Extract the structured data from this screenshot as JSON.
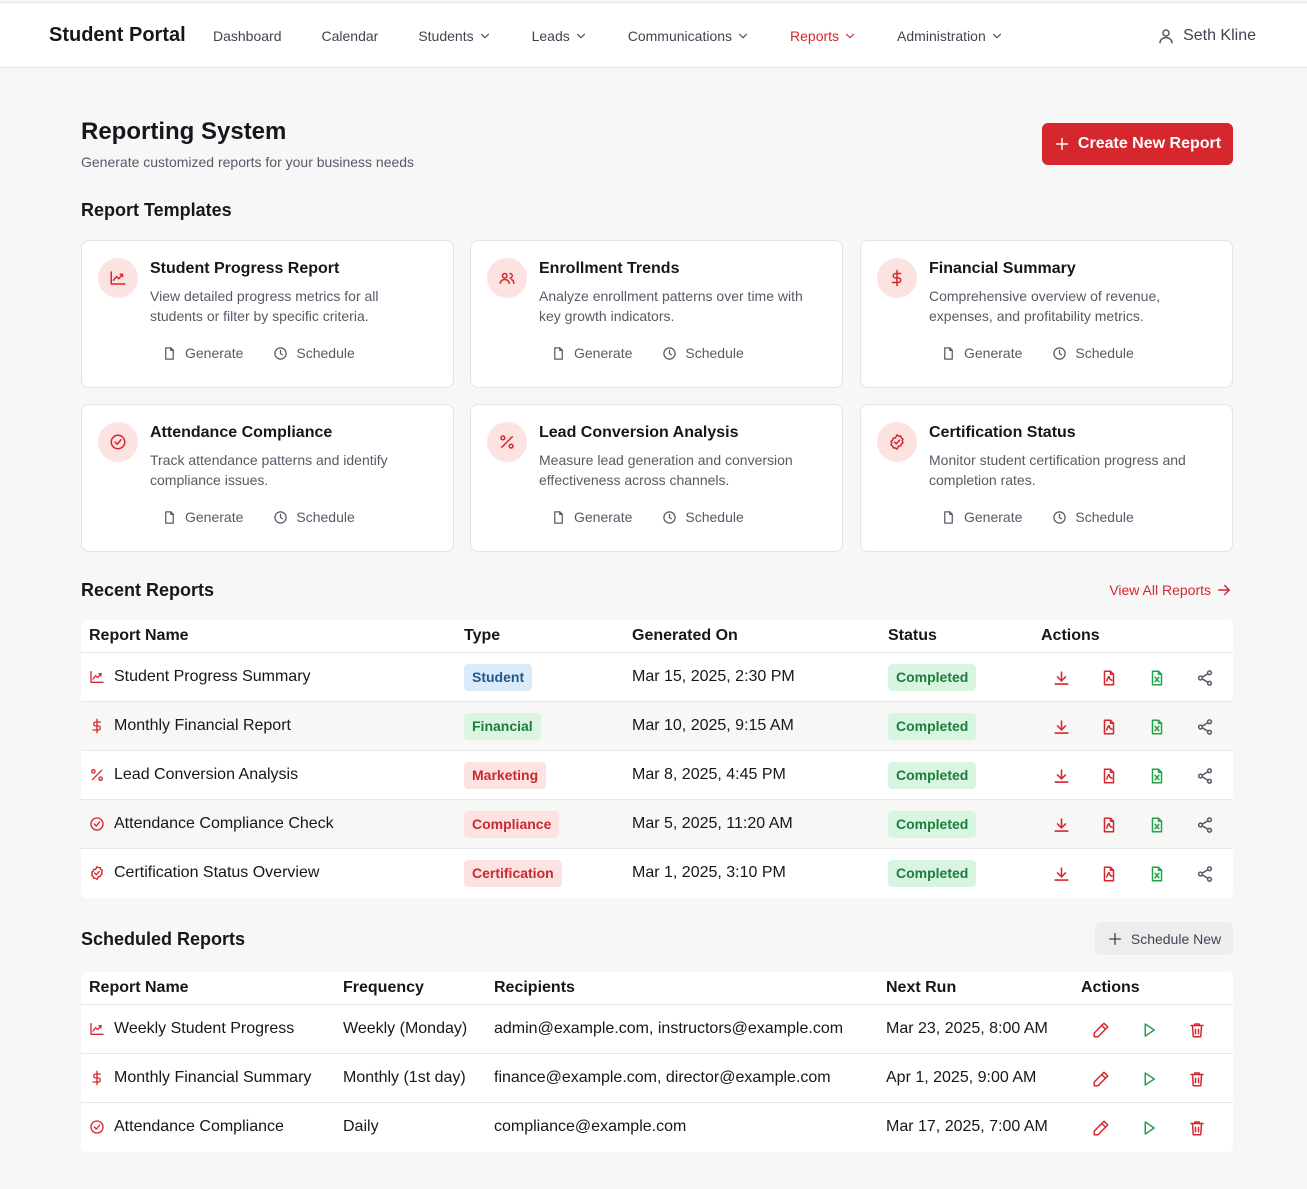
{
  "brand": "Student Portal",
  "nav": [
    {
      "label": "Dashboard",
      "dropdown": false
    },
    {
      "label": "Calendar",
      "dropdown": false
    },
    {
      "label": "Students",
      "dropdown": true
    },
    {
      "label": "Leads",
      "dropdown": true
    },
    {
      "label": "Communications",
      "dropdown": true
    },
    {
      "label": "Reports",
      "dropdown": true,
      "active": true
    },
    {
      "label": "Administration",
      "dropdown": true
    }
  ],
  "user": {
    "name": "Seth Kline"
  },
  "page": {
    "title": "Reporting System",
    "subtitle": "Generate customized reports for your business needs",
    "create_button": "Create New Report"
  },
  "templates": {
    "title": "Report Templates",
    "generate_label": "Generate",
    "schedule_label": "Schedule",
    "items": [
      {
        "title": "Student Progress Report",
        "description": "View detailed progress metrics for all students or filter by specific criteria.",
        "icon": "chart-line-icon"
      },
      {
        "title": "Enrollment Trends",
        "description": "Analyze enrollment patterns over time with key growth indicators.",
        "icon": "users-icon"
      },
      {
        "title": "Financial Summary",
        "description": "Comprehensive overview of revenue, expenses, and profitability metrics.",
        "icon": "dollar-icon"
      },
      {
        "title": "Attendance Compliance",
        "description": "Track attendance patterns and identify compliance issues.",
        "icon": "check-circle-icon"
      },
      {
        "title": "Lead Conversion Analysis",
        "description": "Measure lead generation and conversion effectiveness across channels.",
        "icon": "percent-icon"
      },
      {
        "title": "Certification Status",
        "description": "Monitor student certification progress and completion rates.",
        "icon": "badge-check-icon"
      }
    ]
  },
  "recent": {
    "title": "Recent Reports",
    "view_all": "View All Reports",
    "columns": [
      "Report Name",
      "Type",
      "Generated On",
      "Status",
      "Actions"
    ],
    "rows": [
      {
        "name": "Student Progress Summary",
        "icon": "chart-line-icon",
        "type": "Student",
        "type_style": "student",
        "generated": "Mar 15, 2025, 2:30 PM",
        "status": "Completed"
      },
      {
        "name": "Monthly Financial Report",
        "icon": "dollar-icon",
        "type": "Financial",
        "type_style": "financial",
        "generated": "Mar 10, 2025, 9:15 AM",
        "status": "Completed"
      },
      {
        "name": "Lead Conversion Analysis",
        "icon": "percent-icon",
        "type": "Marketing",
        "type_style": "red",
        "generated": "Mar 8, 2025, 4:45 PM",
        "status": "Completed"
      },
      {
        "name": "Attendance Compliance Check",
        "icon": "check-circle-icon",
        "type": "Compliance",
        "type_style": "red",
        "generated": "Mar 5, 2025, 11:20 AM",
        "status": "Completed"
      },
      {
        "name": "Certification Status Overview",
        "icon": "badge-check-icon",
        "type": "Certification",
        "type_style": "red",
        "generated": "Mar 1, 2025, 3:10 PM",
        "status": "Completed"
      }
    ]
  },
  "scheduled": {
    "title": "Scheduled Reports",
    "schedule_new": "Schedule New",
    "columns": [
      "Report Name",
      "Frequency",
      "Recipients",
      "Next Run",
      "Actions"
    ],
    "rows": [
      {
        "name": "Weekly Student Progress",
        "icon": "chart-line-icon",
        "frequency": "Weekly (Monday)",
        "recipients": "admin@example.com, instructors@example.com",
        "next_run": "Mar 23, 2025, 8:00 AM"
      },
      {
        "name": "Monthly Financial Summary",
        "icon": "dollar-icon",
        "frequency": "Monthly (1st day)",
        "recipients": "finance@example.com, director@example.com",
        "next_run": "Apr 1, 2025, 9:00 AM"
      },
      {
        "name": "Attendance Compliance",
        "icon": "check-circle-icon",
        "frequency": "Daily",
        "recipients": "compliance@example.com",
        "next_run": "Mar 17, 2025, 7:00 AM"
      }
    ]
  },
  "colors": {
    "accent": "#d6262e",
    "success": "#1c7d3c",
    "neutral": "#555b66"
  }
}
